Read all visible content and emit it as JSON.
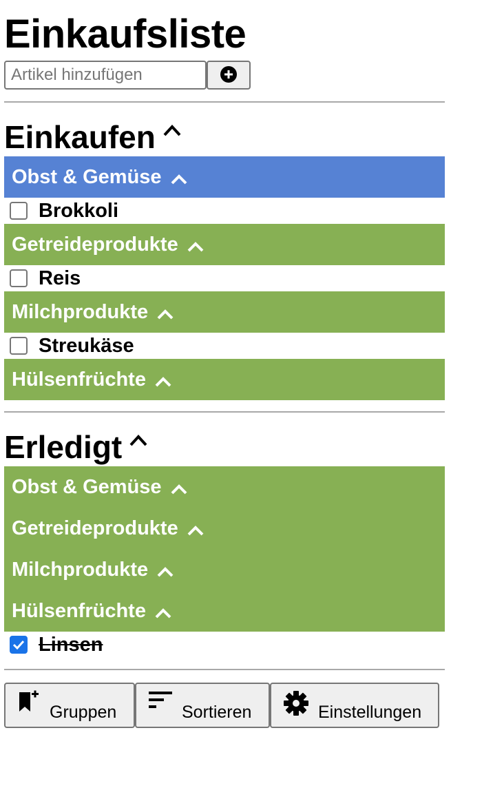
{
  "app": {
    "title": "Einkaufsliste"
  },
  "add": {
    "placeholder": "Artikel hinzufügen",
    "button_icon": "plus-circle-icon"
  },
  "shopping": {
    "title": "Einkaufen",
    "groups": [
      {
        "label": "Obst & Gemüse",
        "color": "#5682d4",
        "items": [
          {
            "label": "Brokkoli",
            "checked": false
          }
        ]
      },
      {
        "label": "Getreideprodukte",
        "color": "#87b054",
        "items": [
          {
            "label": "Reis",
            "checked": false
          }
        ]
      },
      {
        "label": "Milchprodukte",
        "color": "#87b054",
        "items": [
          {
            "label": "Streukäse",
            "checked": false
          }
        ]
      },
      {
        "label": "Hülsenfrüchte",
        "color": "#87b054",
        "items": []
      }
    ]
  },
  "done": {
    "title": "Erledigt",
    "groups": [
      {
        "label": "Obst & Gemüse",
        "color": "#87b054",
        "items": []
      },
      {
        "label": "Getreideprodukte",
        "color": "#87b054",
        "items": []
      },
      {
        "label": "Milchprodukte",
        "color": "#87b054",
        "items": []
      },
      {
        "label": "Hülsenfrüchte",
        "color": "#87b054",
        "items": [
          {
            "label": "Linsen",
            "checked": true
          }
        ]
      }
    ]
  },
  "toolbar": {
    "groups_label": "Gruppen",
    "groups_icon": "bookmark-add-icon",
    "sort_label": "Sortieren",
    "sort_icon": "sort-icon",
    "settings_label": "Einstellungen",
    "settings_icon": "gear-icon"
  },
  "colors": {
    "accent_blue": "#5682d4",
    "group_green": "#87b054",
    "checkbox_checked": "#1a73e8"
  }
}
